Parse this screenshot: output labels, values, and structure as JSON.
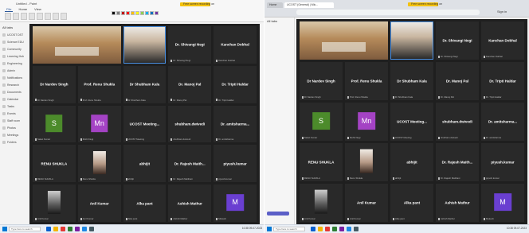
{
  "left_screen": {
    "window_title": "Untitled - Paint",
    "ribbon_tabs": [
      "File",
      "Home",
      "View"
    ],
    "notification": "Free screen recording on",
    "sidebar": {
      "header": "All tabs",
      "items": [
        "UCOST DST",
        "Science EDU",
        "Community",
        "Learning Hub",
        "Engineering",
        "Admin",
        "Notifications",
        "Research",
        "Documents",
        "Calendar",
        "Tasks",
        "Events",
        "Staff room",
        "Photos",
        "Meetings",
        "Folders"
      ]
    },
    "tiles": [
      {
        "name": "",
        "footer": "",
        "kind": "room"
      },
      {
        "name": "",
        "footer": "",
        "kind": "person"
      },
      {
        "name": "Dr. Shivangi Negi",
        "footer": "Dr. Shivangi Negi"
      },
      {
        "name": "Kanchan Dobhal",
        "footer": "Kanchan Dobhal"
      },
      {
        "name": "Dr Nardev Singh",
        "footer": "Dr Nardev Singh"
      },
      {
        "name": "Prof. Renu Shukla",
        "footer": "Prof. Renu Shukla"
      },
      {
        "name": "Dr Shubham Kala",
        "footer": "Dr Shubham Kala"
      },
      {
        "name": "Dr. Manoj Pal",
        "footer": "Dr. Manoj Pal"
      },
      {
        "name": "Dr. Tripti Haldar",
        "footer": "Dr. Tripti Haldar"
      },
      {
        "name": "",
        "footer": "Saket Kumar",
        "avatar": "S",
        "avatar_color": "green"
      },
      {
        "name": "",
        "footer": "Mohit Negi",
        "avatar": "Mn",
        "avatar_color": "purple"
      },
      {
        "name": "UCOST Meeting...",
        "footer": "UCOST Meeting"
      },
      {
        "name": "shubham.dwivedi",
        "footer": "shubham.dwivedi"
      },
      {
        "name": "Dr. amitsharma...",
        "footer": "Dr. amitsharma"
      },
      {
        "name": "RENU SHUKLA",
        "footer": "RENU SHUKLA"
      },
      {
        "name": "",
        "footer": "Renu Shukla",
        "photo": "renu"
      },
      {
        "name": "abhijit",
        "footer": "abhijit"
      },
      {
        "name": "Dr. Rajesh Maith...",
        "footer": "Dr. Rajesh Maithani"
      },
      {
        "name": "piyush.kumar",
        "footer": "piyush.kumar"
      },
      {
        "name": "",
        "footer": "Anil Kumar",
        "photo": "anil"
      },
      {
        "name": "Anil Kumar",
        "footer": "Anil Kumar"
      },
      {
        "name": "Alka pant",
        "footer": "Alka pant"
      },
      {
        "name": "Ashish Mathur",
        "footer": "Ashish Mathur"
      },
      {
        "name": "",
        "footer": "Mukesh",
        "avatar": "M",
        "avatar_color": "indigo"
      }
    ],
    "taskbar": {
      "search": "Type here to search",
      "tray_time": "10:38",
      "tray_date": "09-07-2023"
    }
  },
  "right_screen": {
    "browser_tabs": [
      "Home",
      "UCOST (General) | Mic..."
    ],
    "notification": "Free screen recording on",
    "signin": "Sign in",
    "sidebar_header": "All tabs",
    "tiles": [
      {
        "name": "",
        "footer": "",
        "kind": "room"
      },
      {
        "name": "",
        "footer": "",
        "kind": "person"
      },
      {
        "name": "Dr. Shivangi Negi",
        "footer": "Dr. Shivangi Negi"
      },
      {
        "name": "Kanchan Dobhal",
        "footer": "Kanchan Dobhal"
      },
      {
        "name": "Dr Nardev Singh",
        "footer": "Dr Nardev Singh"
      },
      {
        "name": "Prof. Renu Shukla",
        "footer": "Prof. Renu Shukla"
      },
      {
        "name": "Dr Shubham Kala",
        "footer": "Dr Shubham Kala"
      },
      {
        "name": "Dr. Manoj Pal",
        "footer": "Dr. Manoj Pal"
      },
      {
        "name": "Dr. Tripti Haldar",
        "footer": "Dr. Tripti Haldar"
      },
      {
        "name": "",
        "footer": "Saket Kumar",
        "avatar": "S",
        "avatar_color": "green"
      },
      {
        "name": "",
        "footer": "Mohit Negi",
        "avatar": "Mn",
        "avatar_color": "purple"
      },
      {
        "name": "UCOST Meeting...",
        "footer": "UCOST Meeting"
      },
      {
        "name": "shubham.dwivedi",
        "footer": "shubham.dwivedi"
      },
      {
        "name": "Dr. amitsharma...",
        "footer": "Dr. amitsharma"
      },
      {
        "name": "RENU SHUKLA",
        "footer": "RENU SHUKLA"
      },
      {
        "name": "",
        "footer": "Renu Shukla",
        "photo": "renu"
      },
      {
        "name": "abhijit",
        "footer": "abhijit"
      },
      {
        "name": "Dr. Rajesh Maith...",
        "footer": "Dr. Rajesh Maithani"
      },
      {
        "name": "piyush.kumar",
        "footer": "piyush.kumar"
      },
      {
        "name": "",
        "footer": "Anil Kumar",
        "photo": "anil"
      },
      {
        "name": "Anil Kumar",
        "footer": "Anil Kumar"
      },
      {
        "name": "Alka pant",
        "footer": "Alka pant"
      },
      {
        "name": "Ashish Mathur",
        "footer": "Ashish Mathur"
      },
      {
        "name": "",
        "footer": "Mukesh",
        "avatar": "M",
        "avatar_color": "indigo"
      }
    ],
    "taskbar": {
      "search": "Type here to search",
      "tray_time": "10:38",
      "tray_date": "09-07-2023"
    }
  }
}
